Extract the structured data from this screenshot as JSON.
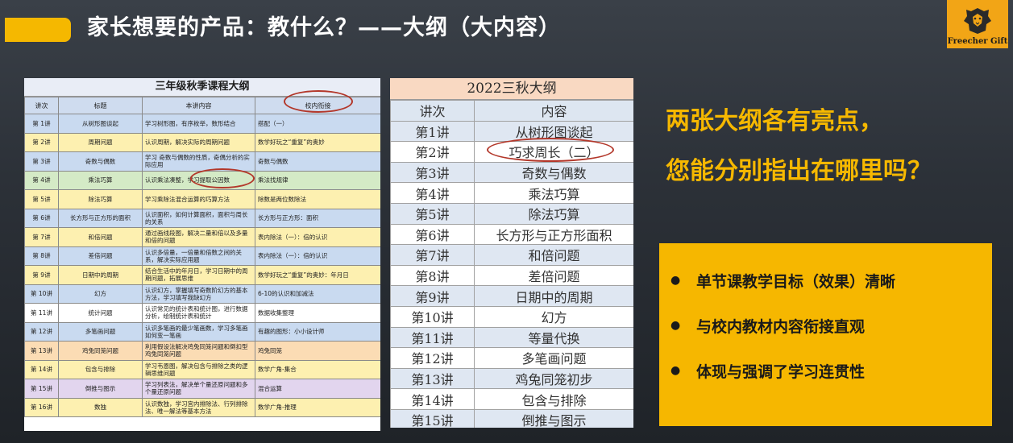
{
  "slide": {
    "title": "家长想要的产品：教什么？——大纲（大内容）",
    "logo_text": "Freecher Gift"
  },
  "table_left": {
    "title": "三年级秋季课程大纲",
    "headers": [
      "讲次",
      "标题",
      "本讲内容",
      "校内衔接"
    ],
    "rows": [
      [
        "第 1讲",
        "从树形图谈起",
        "学习树形图，有序枚举，数形结合",
        "搭配（一）",
        "blue"
      ],
      [
        "第 2讲",
        "周期问题",
        "认识周期，解决实际的周期问题",
        "数学好玩之“重复”的奥妙",
        "yellow"
      ],
      [
        "第 3讲",
        "奇数与偶数",
        "学习 奇数与偶数的性质，奇偶分析的实际应用",
        "奇数与偶数",
        "blue"
      ],
      [
        "第 4讲",
        "乘法巧算",
        "认识乘法凑整，学习提取公因数",
        "乘法找规律",
        "green"
      ],
      [
        "第 5讲",
        "除法巧算",
        "学习乘除法混合运算的巧算方法",
        "除数是两位数除法",
        "yellow"
      ],
      [
        "第 6讲",
        "长方形与正方形的面积",
        "认识面积，如何计算面积，面积与周长的关系",
        "长方形与正方形：面积",
        "blue"
      ],
      [
        "第 7讲",
        "和倍问题",
        "通过画线段图，解决二量和倍以及多量和倍的问题",
        "表内除法（一）：倍的认识",
        "yellow"
      ],
      [
        "第 8讲",
        "差倍问题",
        "认识多倍量，一倍量和倍数之间的关系，解决实际应用题",
        "表内除法（一）：倍的认识",
        "blue"
      ],
      [
        "第 9讲",
        "日期中的周期",
        "结合生活中的年月日，学习日期中的周期问题，拓展思维",
        "数学好玩之“重复”的奥妙：年月日",
        "yellow"
      ],
      [
        "第 10讲",
        "幻方",
        "认识幻方，掌握填写奇数阶幻方的基本方法，学习填写我缺幻方",
        "6-10的认识和加减法",
        "blue"
      ],
      [
        "第 11讲",
        "统计问题",
        "认识常见的统计表和统计图，进行数据分析，绘制统计表和统计",
        "数据收集整理",
        "white"
      ],
      [
        "第 12讲",
        "多笔画问题",
        "认识多笔画的最少笔画数，学习多笔画如何变一笔画",
        "有趣的图形：小小设计师",
        "blue"
      ],
      [
        "第 13讲",
        "鸡兔同笼问题",
        "利用假设法解决鸡兔同笼问题和倒扣型鸡兔同笼问题",
        "鸡兔同笼",
        "orange"
      ],
      [
        "第 14讲",
        "包含与排除",
        "学习韦恩图，解决包含与排除之类的逻辑思维问题",
        "数学广角-集合",
        "yellow"
      ],
      [
        "第 15讲",
        "倒推与图示",
        "学习列表法，解决单个量还原问题和多个量还原问题",
        "混合运算",
        "purple"
      ],
      [
        "第 16讲",
        "数独",
        "认识数独，学习宫内排除法、行列排除法、唯一解法等基本方法",
        "数学广角-推理",
        "yellow"
      ]
    ]
  },
  "table_right": {
    "title": "2022三秋大纲",
    "headers": [
      "讲次",
      "内容"
    ],
    "rows": [
      [
        "第1讲",
        "从树形图谈起"
      ],
      [
        "第2讲",
        "巧求周长（二）"
      ],
      [
        "第3讲",
        "奇数与偶数"
      ],
      [
        "第4讲",
        "乘法巧算"
      ],
      [
        "第5讲",
        "除法巧算"
      ],
      [
        "第6讲",
        "长方形与正方形面积"
      ],
      [
        "第7讲",
        "和倍问题"
      ],
      [
        "第8讲",
        "差倍问题"
      ],
      [
        "第9讲",
        "日期中的周期"
      ],
      [
        "第10讲",
        "幻方"
      ],
      [
        "第11讲",
        "等量代换"
      ],
      [
        "第12讲",
        "多笔画问题"
      ],
      [
        "第13讲",
        "鸡兔同笼初步"
      ],
      [
        "第14讲",
        "包含与排除"
      ],
      [
        "第15讲",
        "倒推与图示"
      ]
    ]
  },
  "question": {
    "line1": "两张大纲各有亮点，",
    "line2": "您能分别指出在哪里吗？"
  },
  "points": [
    "单节课教学目标（效果）清晰",
    "与校内教材内容衔接直观",
    "体现与强调了学习连贯性"
  ],
  "colors": {
    "accent": "#f5b800",
    "highlight_circle": "#b3372a"
  }
}
